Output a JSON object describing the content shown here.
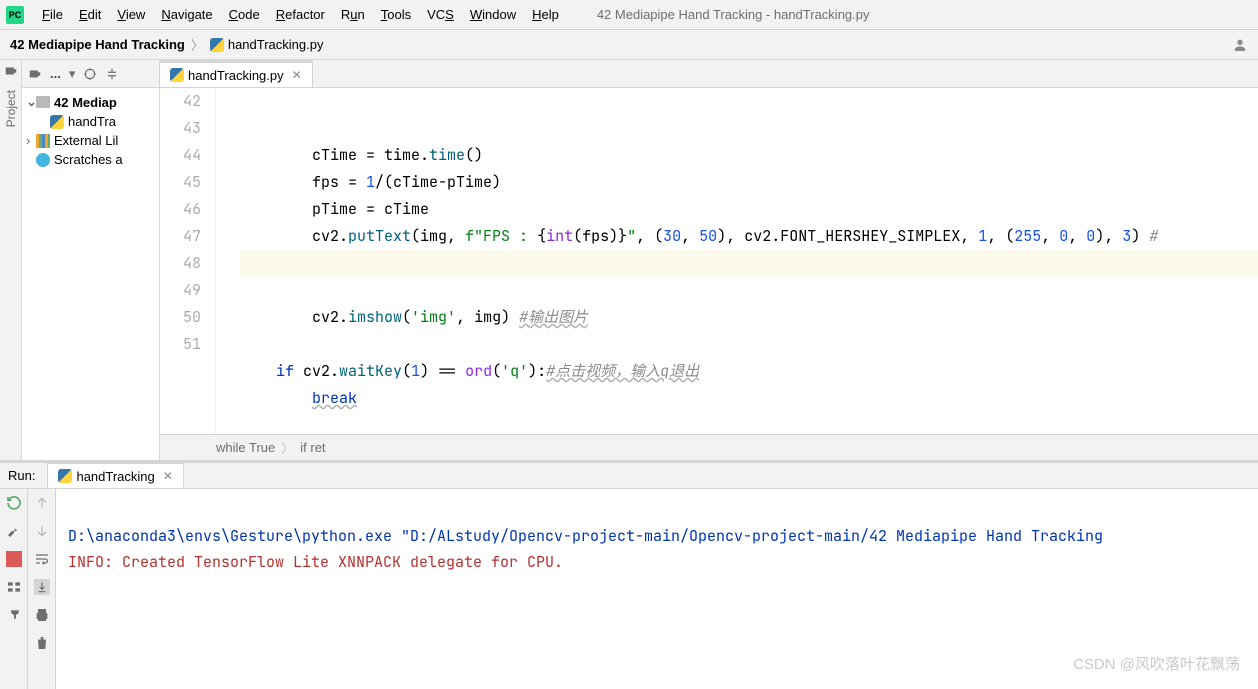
{
  "menu": {
    "items": [
      "File",
      "Edit",
      "View",
      "Navigate",
      "Code",
      "Refactor",
      "Run",
      "Tools",
      "VCS",
      "Window",
      "Help"
    ],
    "window_title": "42 Mediapipe Hand Tracking - handTracking.py"
  },
  "breadcrumb": {
    "root": "42 Mediapipe Hand Tracking",
    "file": "handTracking.py"
  },
  "side_tab": {
    "label": "Project"
  },
  "project_tree": {
    "root": "42 Mediap",
    "file": "handTra",
    "external": "External Lil",
    "scratches": "Scratches a"
  },
  "editor": {
    "tab": "handTracking.py",
    "lines": [
      {
        "num": "42",
        "code": ""
      },
      {
        "num": "43",
        "code": "        cTime = time.time()"
      },
      {
        "num": "44",
        "code": "        fps = 1/(cTime-pTime)"
      },
      {
        "num": "45",
        "code": "        pTime = cTime"
      },
      {
        "num": "46",
        "code": "        cv2.putText(img, f\"FPS : {int(fps)}\", (30, 50), cv2.FONT_HERSHEY_SIMPLEX, 1, (255, 0, 0), 3) #"
      },
      {
        "num": "47",
        "code": ""
      },
      {
        "num": "48",
        "code": "        cv2.imshow('img', img) #输出图片"
      },
      {
        "num": "49",
        "code": ""
      },
      {
        "num": "50",
        "code": "    if cv2.waitKey(1) == ord('q'):#点击视频，输入q退出"
      },
      {
        "num": "51",
        "code": "        break"
      }
    ],
    "footer_crumbs": [
      "while True",
      "if ret"
    ]
  },
  "run": {
    "label": "Run:",
    "tab": "handTracking",
    "console_line1": "D:\\anaconda3\\envs\\Gesture\\python.exe \"D:/ALstudy/Opencv-project-main/Opencv-project-main/42 Mediapipe Hand Tracking",
    "console_line2": "INFO: Created TensorFlow Lite XNNPACK delegate for CPU."
  },
  "watermark": "CSDN @风吹落叶花飘荡"
}
